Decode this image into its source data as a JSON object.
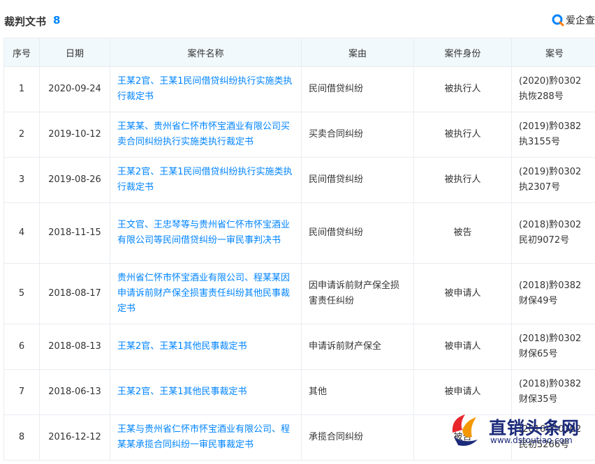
{
  "header": {
    "title": "裁判文书",
    "count": "8",
    "brand": "爱企查",
    "brand_icon": "aiqicha-logo-icon",
    "brand_color": "#0084ff"
  },
  "table": {
    "columns": [
      "序号",
      "日期",
      "案件名称",
      "案由",
      "案件身份",
      "案号"
    ],
    "rows": [
      {
        "no": "1",
        "date": "2020-09-24",
        "name": "王某2官、王某1民间借贷纠纷执行实施类执行裁定书",
        "cause": "民间借贷纠纷",
        "role": "被执行人",
        "case_no": "(2020)黔0302执恢288号"
      },
      {
        "no": "2",
        "date": "2019-10-12",
        "name": "王某某、贵州省仁怀市怀宝酒业有限公司买卖合同纠纷执行实施类执行裁定书",
        "cause": "买卖合同纠纷",
        "role": "被执行人",
        "case_no": "(2019)黔0382执3155号"
      },
      {
        "no": "3",
        "date": "2019-08-26",
        "name": "王某2官、王某1民间借贷纠纷执行实施类执行裁定书",
        "cause": "民间借贷纠纷",
        "role": "被执行人",
        "case_no": "(2019)黔0302执2307号"
      },
      {
        "no": "4",
        "date": "2018-11-15",
        "name": "王文官、王忠琴等与贵州省仁怀市怀宝酒业有限公司等民间借贷纠纷一审民事判决书",
        "cause": "民间借贷纠纷",
        "role": "被告",
        "case_no": "(2018)黔0302民初9072号"
      },
      {
        "no": "5",
        "date": "2018-08-17",
        "name": "贵州省仁怀市怀宝酒业有限公司、程某某因申请诉前财产保全损害责任纠纷其他民事裁定书",
        "cause": "因申请诉前财产保全损害责任纠纷",
        "role": "被申请人",
        "case_no": "(2018)黔0382财保49号"
      },
      {
        "no": "6",
        "date": "2018-08-13",
        "name": "王某2官、王某1其他民事裁定书",
        "cause": "申请诉前财产保全",
        "role": "被申请人",
        "case_no": "(2018)黔0302财保65号"
      },
      {
        "no": "7",
        "date": "2018-06-13",
        "name": "王某2官、王某1其他民事裁定书",
        "cause": "其他",
        "role": "被申请人",
        "case_no": "(2018)黔0382财保35号"
      },
      {
        "no": "8",
        "date": "2016-12-12",
        "name": "王某与贵州省仁怀市怀宝酒业有限公司、程某某承揽合同纠纷一审民事裁定书",
        "cause": "承揽合同纠纷",
        "role": "被告",
        "case_no": "(2016)黔0302民初5266号"
      }
    ]
  },
  "watermark": {
    "name": "直销头条网",
    "url": "www.dstoutiao.com",
    "logo_icon": "dstoutiao-logo-icon"
  }
}
